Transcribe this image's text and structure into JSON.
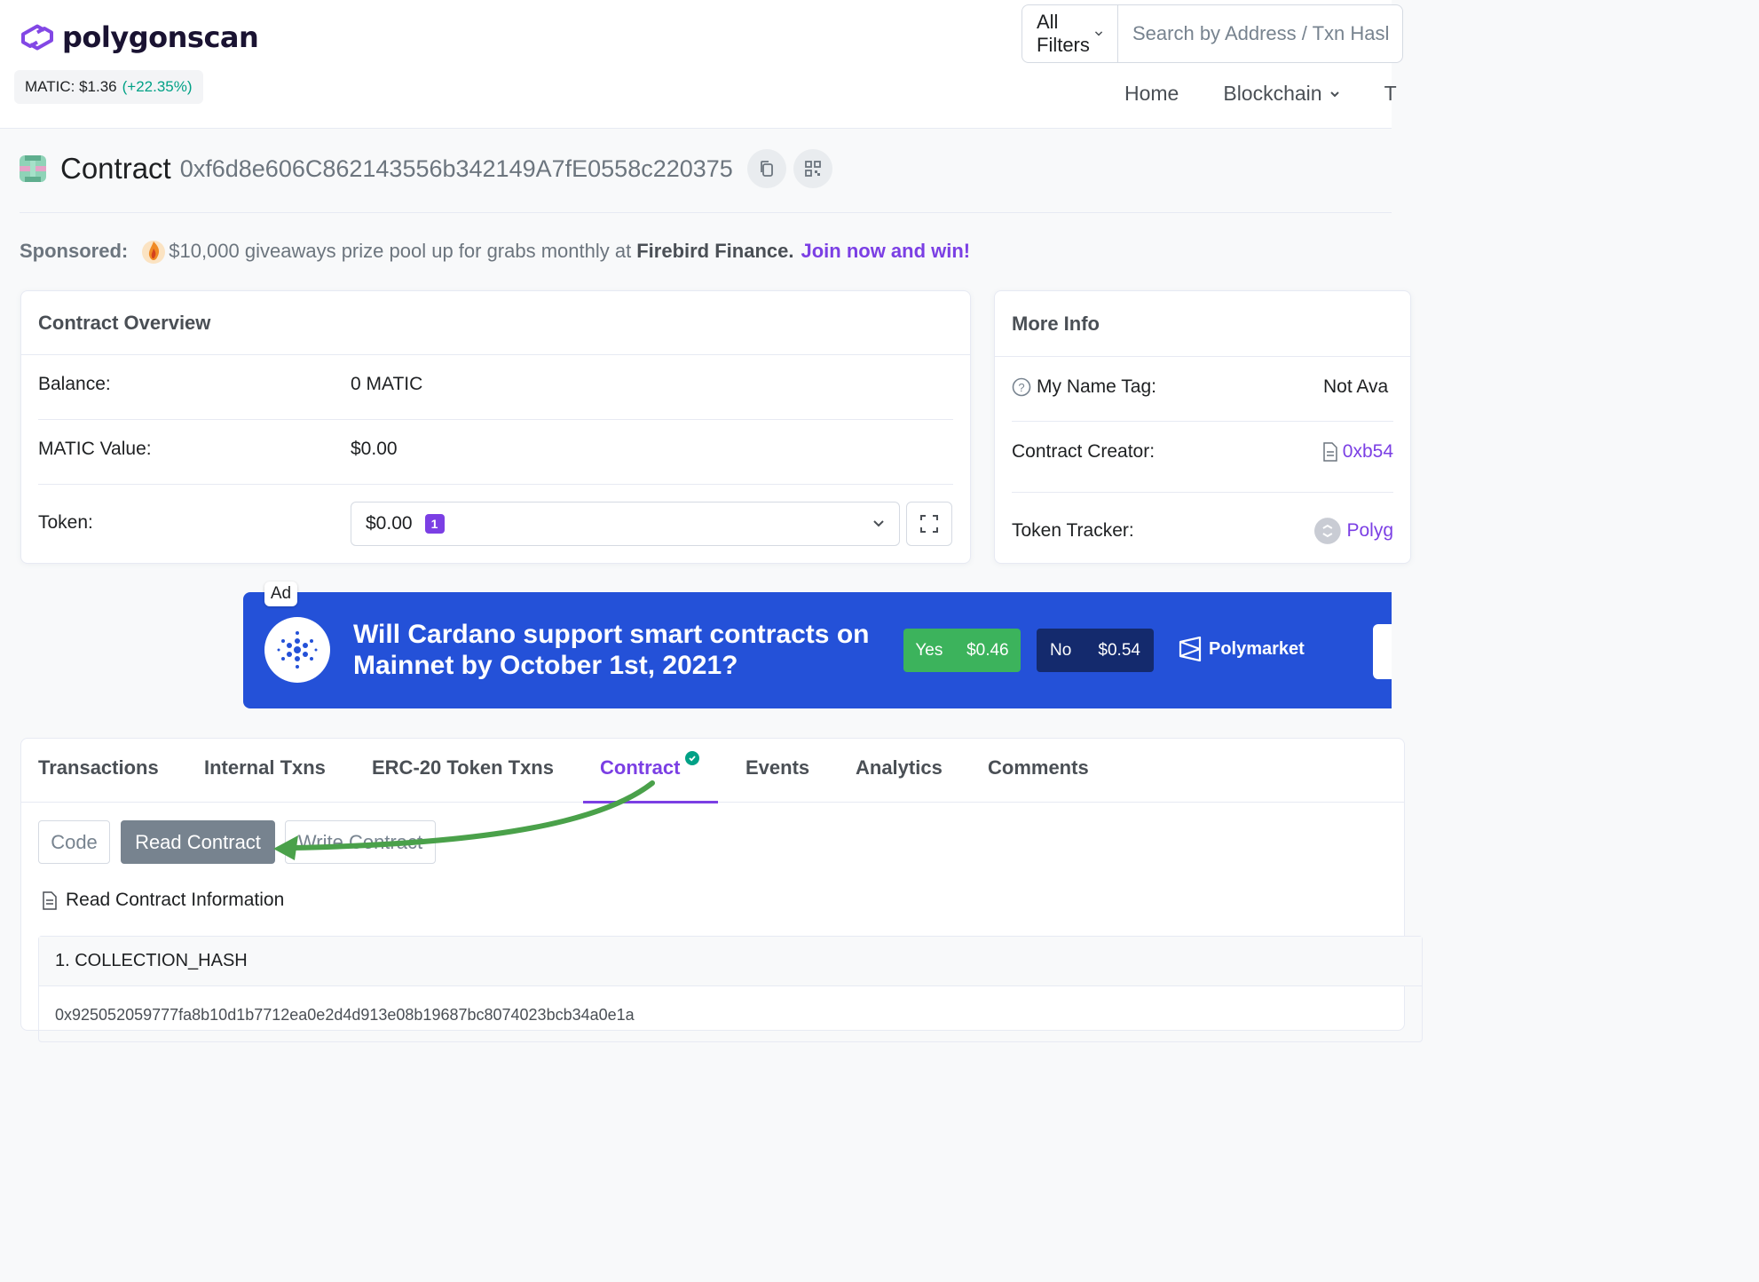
{
  "header": {
    "logo_text": "polygonscan",
    "price_label": "MATIC: $1.36",
    "price_change": "(+22.35%)",
    "filter_label": "All Filters",
    "search_placeholder": "Search by Address / Txn Hash / Block / Token",
    "nav": [
      "Home",
      "Blockchain",
      "T"
    ]
  },
  "contract": {
    "title_word": "Contract",
    "address": "0xf6d8e606C862143556b342149A7fE0558c220375"
  },
  "sponsored": {
    "label": "Sponsored:",
    "text": "$10,000 giveaways prize pool up for grabs monthly at",
    "brand": "Firebird Finance.",
    "cta": "Join now and win!"
  },
  "overview": {
    "title": "Contract Overview",
    "rows": [
      {
        "key": "Balance:",
        "value": "0 MATIC"
      },
      {
        "key": "MATIC Value:",
        "value": "$0.00"
      },
      {
        "key": "Token:",
        "value": "$0.00",
        "badge": "1"
      }
    ]
  },
  "more_info": {
    "title": "More Info",
    "rows": [
      {
        "key": "My Name Tag:",
        "value": "Not Ava"
      },
      {
        "key": "Contract Creator:",
        "value": "0xb54"
      },
      {
        "key": "Token Tracker:",
        "value": "Polyg"
      }
    ]
  },
  "ad": {
    "tag": "Ad",
    "question_line1": "Will Cardano support smart contracts on",
    "question_line2": "Mainnet by October 1st, 2021?",
    "yes_label": "Yes",
    "yes_price": "$0.46",
    "no_label": "No",
    "no_price": "$0.54",
    "brand": "Polymarket",
    "colors": {
      "bg": "#2451d8",
      "yes": "#3cb35c",
      "no": "#142a6d"
    }
  },
  "tabs": [
    "Transactions",
    "Internal Txns",
    "ERC-20 Token Txns",
    "Contract",
    "Events",
    "Analytics",
    "Comments"
  ],
  "active_tab": "Contract",
  "sub_tabs": [
    "Code",
    "Read Contract",
    "Write Contract"
  ],
  "active_sub_tab": "Read Contract",
  "read_info_label": "Read Contract Information",
  "methods": [
    {
      "title": "1. COLLECTION_HASH",
      "value": "0x925052059777fa8b10d1b7712ea0e2d4d913e08b19687bc8074023bcb34a0e1a"
    }
  ],
  "colors": {
    "accent": "#7b3fe4",
    "positive": "#00a186",
    "annotation_arrow": "#4aa14a"
  }
}
